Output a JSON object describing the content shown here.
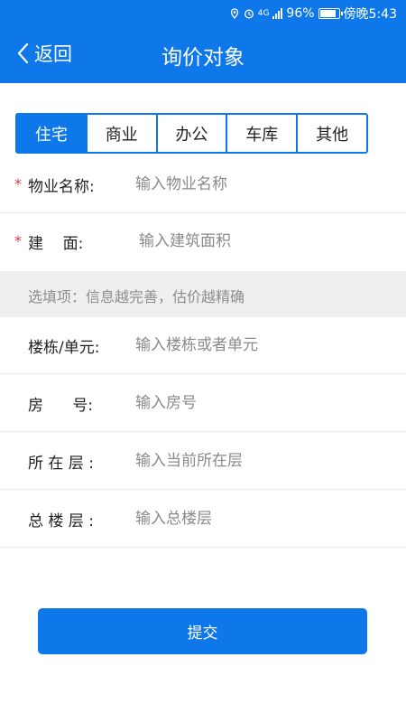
{
  "status_bar": {
    "network": "4G",
    "battery": "96%",
    "time": "傍晚5:43"
  },
  "nav": {
    "back_label": "返回",
    "title": "询价对象"
  },
  "property_types": [
    "住宅",
    "商业",
    "办公",
    "车库",
    "其他"
  ],
  "selected_type": "住宅",
  "required_fields": {
    "name": {
      "label": "物业名称:",
      "placeholder": "输入物业名称",
      "value": ""
    },
    "area": {
      "label": "建    面:",
      "placeholder": "输入建筑面积",
      "value": ""
    }
  },
  "required_mark": "*",
  "optional_hint": "选填项：信息越完善，估价越精确",
  "optional_fields": {
    "building": {
      "label": "楼栋/单元:",
      "placeholder": "输入楼栋或者单元",
      "value": ""
    },
    "room": {
      "label": "房      号:",
      "placeholder": "输入房号",
      "value": ""
    },
    "floor": {
      "label": "所 在 层 :",
      "placeholder": "输入当前所在层",
      "value": ""
    },
    "total_floors": {
      "label": "总 楼 层 :",
      "placeholder": "输入总楼层",
      "value": ""
    }
  },
  "submit_label": "提交",
  "colors": {
    "primary": "#0e78ea",
    "required": "#e0393e",
    "hint_bg": "#efefef"
  },
  "icons": [
    "location-icon",
    "alarm-icon",
    "signal-icon",
    "battery-icon",
    "back-chevron-icon"
  ]
}
